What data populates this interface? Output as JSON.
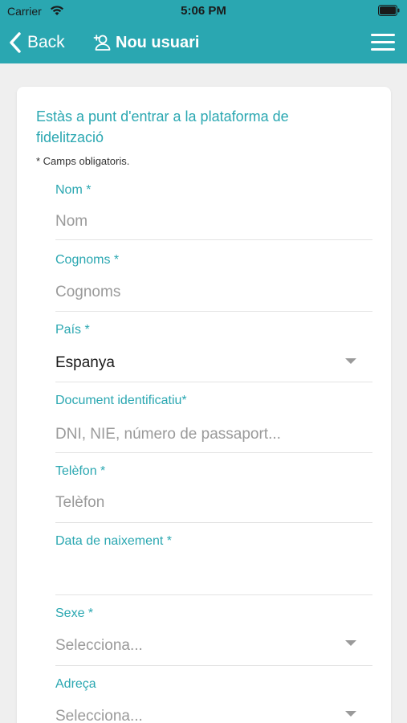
{
  "status_bar": {
    "carrier": "Carrier",
    "time": "5:06 PM"
  },
  "nav": {
    "back_label": "Back",
    "title": "Nou usuari",
    "title_icon": "add-user-icon",
    "menu_icon": "hamburger-menu-icon"
  },
  "colors": {
    "accent": "#2aa7b1",
    "background": "#efefef",
    "card": "#ffffff"
  },
  "form": {
    "intro": "Estàs a punt d'entrar a la plataforma de fidelització",
    "required_note": "* Camps obligatoris.",
    "fields": [
      {
        "label": "Nom *",
        "placeholder": "Nom",
        "value": ""
      },
      {
        "label": "Cognoms *",
        "placeholder": "Cognoms",
        "value": ""
      },
      {
        "label": "País *",
        "placeholder": "",
        "value": "Espanya"
      },
      {
        "label": "Document identificatiu*",
        "placeholder": "DNI, NIE, número de passaport...",
        "value": ""
      },
      {
        "label": "Telèfon *",
        "placeholder": "Telèfon",
        "value": ""
      },
      {
        "label": "Data de naixement *",
        "placeholder": "",
        "value": ""
      },
      {
        "label": "Sexe *",
        "placeholder": "Selecciona...",
        "value": ""
      },
      {
        "label": "Adreça",
        "placeholder": "Selecciona...",
        "value": ""
      }
    ]
  }
}
